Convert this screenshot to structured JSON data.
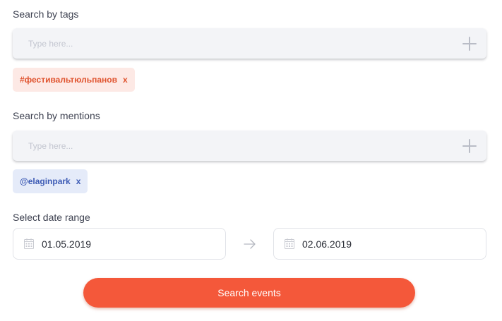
{
  "tags": {
    "label": "Search by tags",
    "placeholder": "Type here...",
    "add_icon": "plus-icon",
    "chips": [
      {
        "text": "#фестивальтюльпанов",
        "remove": "x"
      }
    ]
  },
  "mentions": {
    "label": "Search by mentions",
    "placeholder": "Type here...",
    "add_icon": "plus-icon",
    "chips": [
      {
        "text": "@elaginpark",
        "remove": "x"
      }
    ]
  },
  "date_range": {
    "label": "Select date range",
    "start": "01.05.2019",
    "end": "02.06.2019",
    "icon": "calendar-icon",
    "separator_icon": "arrow-right-icon"
  },
  "search_button": {
    "label": "Search events"
  },
  "colors": {
    "accent": "#f4583a",
    "tag_chip_bg": "#fde9e5",
    "tag_chip_text": "#e0542f",
    "mention_chip_bg": "#e5ebf9",
    "mention_chip_text": "#3d5bb5"
  }
}
